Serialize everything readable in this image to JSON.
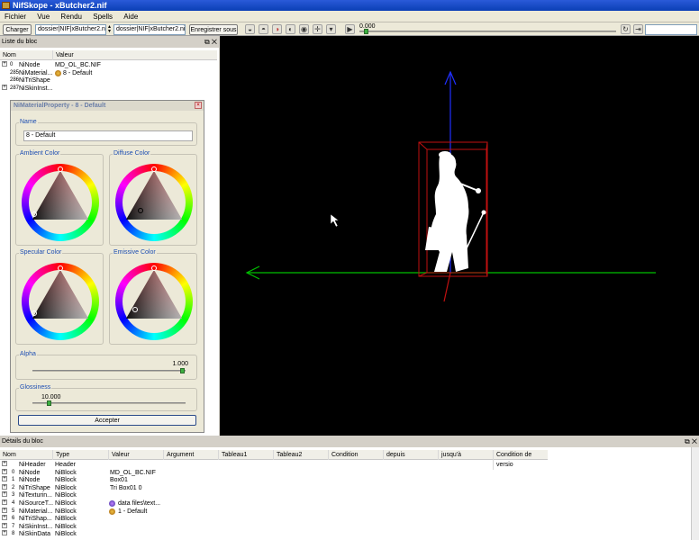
{
  "app": {
    "title": "NifSkope - xButcher2.nif"
  },
  "menu": [
    "Fichier",
    "Vue",
    "Rendu",
    "Spells",
    "Aide"
  ],
  "toolbar": {
    "load_label": "Charger",
    "path1": "dossier|NIF|xButcher2.nif",
    "path2": "dossier|NIF|xButcher2.nif",
    "save_label": "Enregistrer sous",
    "time_value": "0.000"
  },
  "block_list": {
    "title": "Liste du bloc",
    "columns": [
      "Nom",
      "Valeur"
    ],
    "rows": [
      {
        "expander": "+",
        "index": "0",
        "name": "NiNode",
        "value": "MD_OL_BC.NIF"
      },
      {
        "expander": "",
        "index": "285",
        "name": "NiMaterial...",
        "value": "8 - Default"
      },
      {
        "expander": "",
        "index": "286",
        "name": "NiTriShape",
        "value": ""
      },
      {
        "expander": "+",
        "index": "287",
        "name": "NiSkinInst...",
        "value": ""
      }
    ]
  },
  "material_dialog": {
    "title": "NiMaterialProperty - 8 - Default",
    "name_label": "Name",
    "name_value": "8 - Default",
    "colors": [
      {
        "label": "Ambient Color",
        "picker": "dark"
      },
      {
        "label": "Diffuse Color",
        "picker": "mid"
      },
      {
        "label": "Specular Color",
        "picker": "dark"
      },
      {
        "label": "Emissive Color",
        "picker": "edge"
      }
    ],
    "alpha_label": "Alpha",
    "alpha_value": "1.000",
    "alpha_level": 1.0,
    "glossiness_label": "Glossiness",
    "glossiness_value": "10.000",
    "glossiness_level": 0.1,
    "accept_label": "Accepter"
  },
  "details": {
    "title": "Détails du bloc",
    "columns": [
      "Nom",
      "Type",
      "Valeur",
      "Argument",
      "Tableau1",
      "Tableau2",
      "Condition",
      "depuis",
      "jusqu'à",
      "Condition de versio"
    ],
    "rows": [
      {
        "index": "",
        "name": "NiHeader",
        "type": "Header",
        "value": "",
        "icon": ""
      },
      {
        "index": "0",
        "name": "NiNode",
        "type": "NiBlock",
        "value": "MD_OL_BC.NIF",
        "icon": ""
      },
      {
        "index": "1",
        "name": "NiNode",
        "type": "NiBlock",
        "value": "Box01",
        "icon": ""
      },
      {
        "index": "2",
        "name": "NiTriShape",
        "type": "NiBlock",
        "value": "Tri Box01 0",
        "icon": ""
      },
      {
        "index": "3",
        "name": "NiTexturin...",
        "type": "NiBlock",
        "value": "",
        "icon": ""
      },
      {
        "index": "4",
        "name": "NiSourceT...",
        "type": "NiBlock",
        "value": "data files\\text...",
        "icon": "texture-icon"
      },
      {
        "index": "5",
        "name": "NiMaterial...",
        "type": "NiBlock",
        "value": "1 - Default",
        "icon": "material-icon"
      },
      {
        "index": "6",
        "name": "NiTriShap...",
        "type": "NiBlock",
        "value": "",
        "icon": ""
      },
      {
        "index": "7",
        "name": "NiSkinInst...",
        "type": "NiBlock",
        "value": "",
        "icon": ""
      },
      {
        "index": "8",
        "name": "NiSkinData",
        "type": "NiBlock",
        "value": "",
        "icon": ""
      }
    ]
  },
  "colors": {
    "title_bar": "#0a3fb5",
    "viewport_bg": "#000000",
    "axis_x": "#00c000",
    "axis_y": "#2030ff",
    "bbox": "#c01010"
  }
}
